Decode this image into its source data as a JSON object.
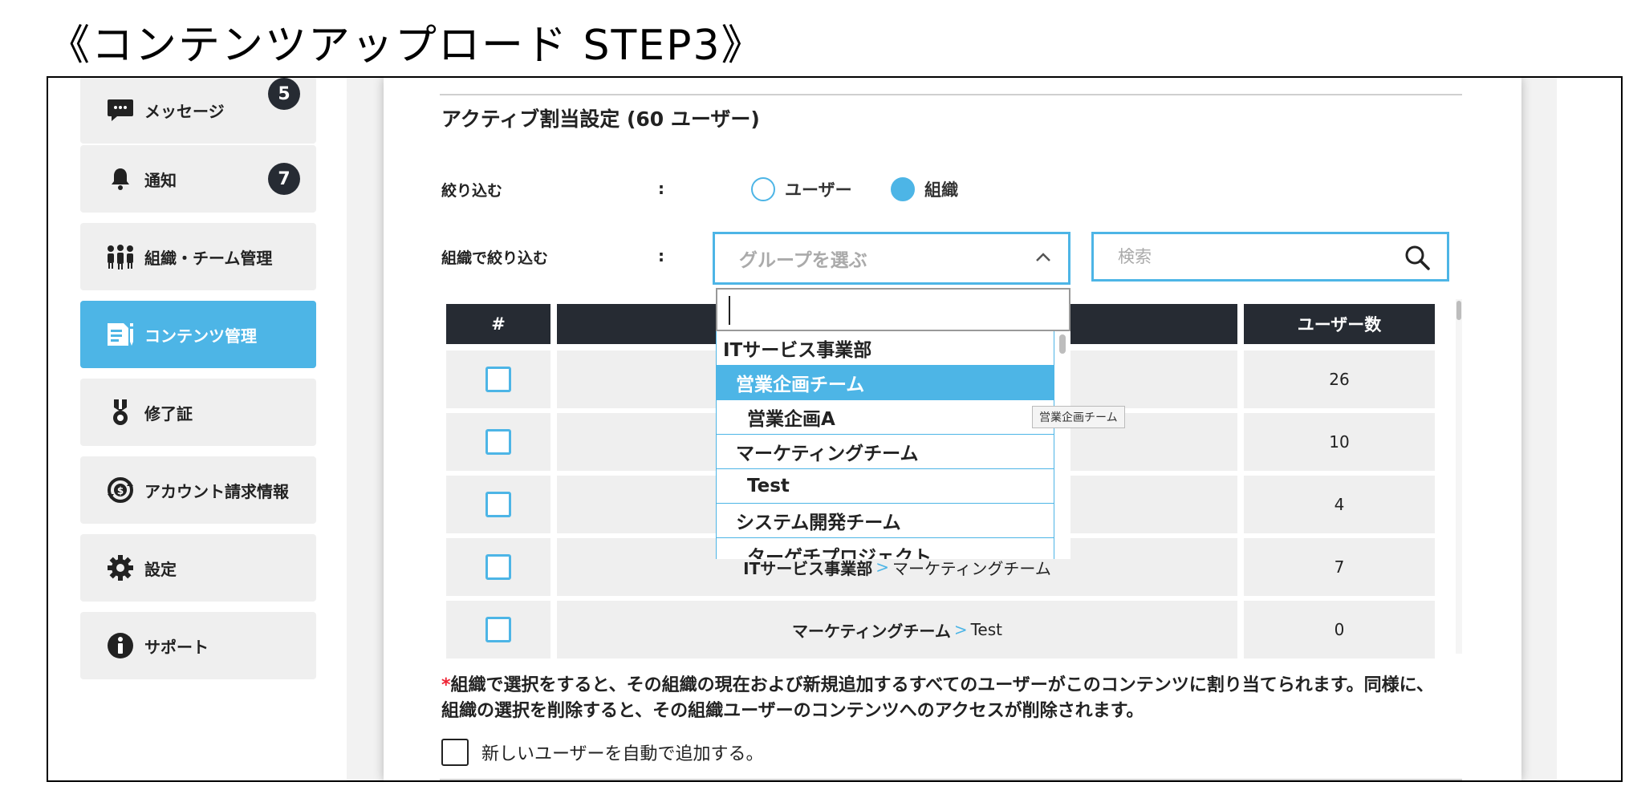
{
  "slide_title": "《コンテンツアップロード STEP3》",
  "sidebar": {
    "items": [
      {
        "label": "メッセージ",
        "badge": "5",
        "icon": "message-icon"
      },
      {
        "label": "通知",
        "badge": "7",
        "icon": "bell-icon"
      },
      {
        "label": "組織・チーム管理",
        "icon": "team-icon"
      },
      {
        "label": "コンテンツ管理",
        "icon": "content-icon",
        "active": true
      },
      {
        "label": "修了証",
        "icon": "medal-icon"
      },
      {
        "label": "アカウント請求情報",
        "icon": "billing-icon"
      },
      {
        "label": "設定",
        "icon": "gear-icon"
      },
      {
        "label": "サポート",
        "icon": "info-icon"
      }
    ]
  },
  "main": {
    "section_title": "アクティブ割当設定 (60 ユーザー)",
    "filter_label": "絞り込む",
    "colon": ":",
    "radio_user": "ユーザー",
    "radio_org": "組織",
    "radio_selected": "組織",
    "org_filter_label": "組織で絞り込む",
    "select_placeholder": "グループを選ぶ",
    "search_placeholder": "検索",
    "table": {
      "headers": [
        "#",
        "",
        "ユーザー数"
      ],
      "rows": [
        {
          "group": "",
          "sub": "",
          "count": "26"
        },
        {
          "group": "",
          "sub": "",
          "count": "10"
        },
        {
          "group": "",
          "sub": "",
          "count": "4"
        },
        {
          "group": "ITサービス事業部",
          "sub": "マーケティングチーム",
          "count": "7"
        },
        {
          "group": "マーケティングチーム",
          "sub": "Test",
          "count": "0"
        }
      ],
      "separator": ">"
    },
    "dropdown": {
      "items": [
        {
          "label": "ITサービス事業部",
          "level": 0
        },
        {
          "label": "営業企画チーム",
          "level": 1,
          "selected": true
        },
        {
          "label": "営業企画A",
          "level": 2
        },
        {
          "label": "マーケティングチーム",
          "level": 1
        },
        {
          "label": "Test",
          "level": 2
        },
        {
          "label": "システム開発チーム",
          "level": 1
        },
        {
          "label": "ターゲチプロジェクト",
          "level": 2
        }
      ]
    },
    "tooltip": "営業企画チーム",
    "note_star": "*",
    "note": "組織で選択をすると、その組織の現在および新規追加するすべてのユーザーがこのコンテンツに割り当てられます。同様に、組織の選択を削除すると、その組織ユーザーのコンテンツへのアクセスが削除されます。",
    "auto_add_label": "新しいユーザーを自動で追加する。"
  },
  "colors": {
    "accent": "#4db5e6",
    "header_dark": "#262b33",
    "cell_bg": "#efefef"
  }
}
